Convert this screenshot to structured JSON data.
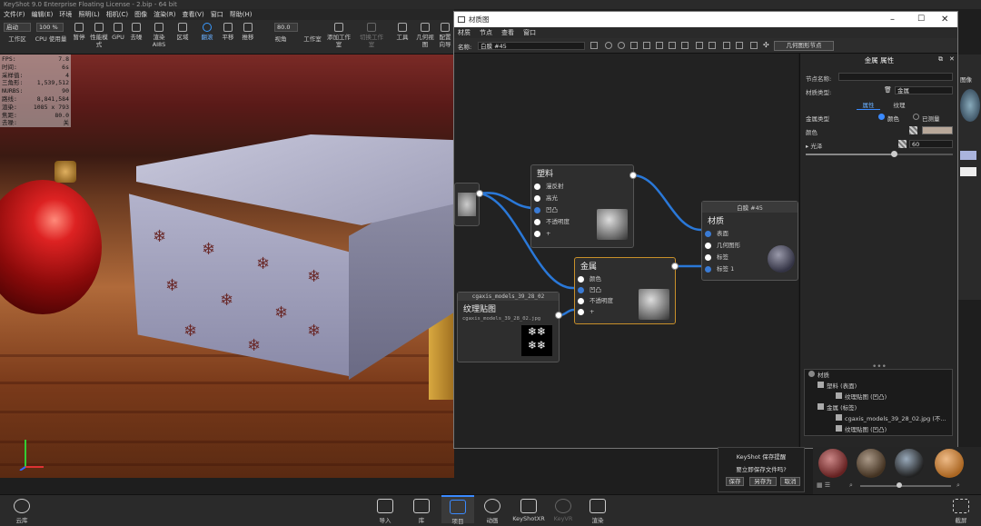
{
  "titlebar": {
    "text": "KeyShot 9.0 Enterprise Floating License - 2.bip - 64 bit"
  },
  "menu": [
    "文件(F)",
    "编辑(E)",
    "环境",
    "照明(L)",
    "相机(C)",
    "图像",
    "渲染(R)",
    "查看(V)",
    "窗口",
    "帮助(H)"
  ],
  "toolbar": {
    "mode": "启动",
    "cpu_label": "CPU 使用量",
    "zoom": "100 %",
    "fov": "80.0",
    "items": [
      "工作区",
      "CPU 使用量",
      "暂停",
      "性能模式",
      "GPU",
      "去噪",
      "渲染 AI8S",
      "区域",
      "翻滚",
      "平移",
      "推移",
      "视角",
      "工作室",
      "添加工作室",
      "切换工作室",
      "工具",
      "几何视图",
      "配置向导"
    ]
  },
  "stats": [
    {
      "k": "FPS:",
      "v": "7.8"
    },
    {
      "k": "时间:",
      "v": "6s"
    },
    {
      "k": "采样值:",
      "v": "4"
    },
    {
      "k": "三角形:",
      "v": "1,539,512"
    },
    {
      "k": "NURBS:",
      "v": "90"
    },
    {
      "k": "路线:",
      "v": "8,841,584"
    },
    {
      "k": "渲染:",
      "v": "1085 x 793"
    },
    {
      "k": "焦距:",
      "v": "80.0"
    },
    {
      "k": "去噪:",
      "v": "关"
    }
  ],
  "matwin": {
    "title": "材质图",
    "menu": [
      "材质",
      "节点",
      "查看",
      "窗口"
    ],
    "name_label": "名称:",
    "name_value": "白膜 #45",
    "geom_node_button": "几何图形节点"
  },
  "nodes": {
    "plastic": {
      "title": "塑料",
      "ports": [
        "漫反射",
        "高光",
        "凹凸",
        "不透明度",
        "+"
      ]
    },
    "metal": {
      "title": "金属",
      "ports": [
        "颜色",
        "凹凸",
        "不透明度",
        "+"
      ]
    },
    "material": {
      "header": "白膜 #45",
      "title": "材质",
      "ports": [
        "表面",
        "几何图形",
        "标签",
        "标签 1"
      ]
    },
    "texture": {
      "header": "cgaxis_models_39_28_02",
      "title": "纹理贴图",
      "file": "cgaxis_models_39_28_02.jpg"
    }
  },
  "props": {
    "panel_title": "金属 属性",
    "node_name_label": "节点名称:",
    "node_name_value": "",
    "material_type_label": "材质类型:",
    "material_type_value": "金属",
    "tab_properties": "属性",
    "tab_texture": "纹理",
    "metal_type_label": "金属类型",
    "option_color": "颜色",
    "option_measured": "已测量",
    "color_label": "颜色",
    "roughness_label": "光泽",
    "roughness_value": "60",
    "color_hex": "#b8a89a"
  },
  "tree": [
    {
      "label": "材质",
      "indent": 0
    },
    {
      "label": "塑料 (表面)",
      "indent": 1
    },
    {
      "label": "纹理贴图 (凹凸)",
      "indent": 2
    },
    {
      "label": "金属 (标签)",
      "indent": 1
    },
    {
      "label": "cgaxis_models_39_28_02.jpg (不...",
      "indent": 2
    },
    {
      "label": "纹理贴图 (凹凸)",
      "indent": 2
    }
  ],
  "savebox": {
    "title": "KeyShot 保存提醒",
    "message": "要立即保存文件吗?",
    "save": "保存",
    "save_as": "另存为",
    "cancel": "取消"
  },
  "bottombar": {
    "cloud": "云库",
    "import": "导入",
    "library": "库",
    "project": "项目",
    "animation": "动画",
    "keyshotxr": "KeyShotXR",
    "keyvr": "KeyVR",
    "render": "渲染",
    "screenshot": "截屏"
  },
  "right_strip": {
    "label": "图像"
  }
}
